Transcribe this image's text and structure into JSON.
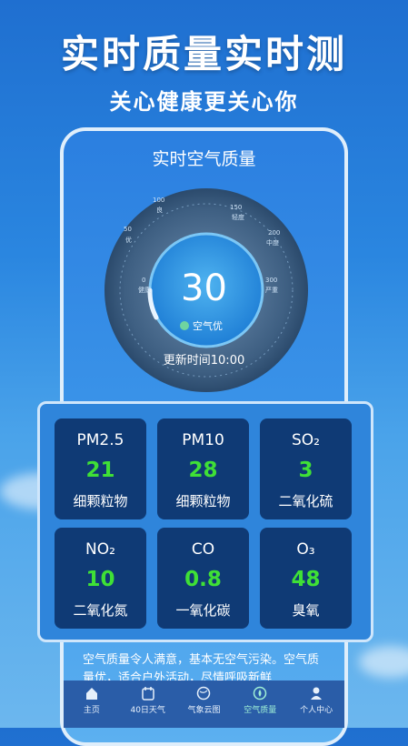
{
  "headline": "实时质量实时测",
  "subline": "关心健康更关心你",
  "screen": {
    "title": "实时空气质量",
    "aqi_value": "30",
    "aqi_level": "空气优",
    "update_time": "更新时间10:00",
    "gauge_ticks": [
      "0",
      "健康",
      "50",
      "优",
      "100",
      "良",
      "150",
      "轻度",
      "200",
      "中度",
      "300",
      "严重"
    ]
  },
  "pollutants": [
    {
      "name": "PM2.5",
      "value": "21",
      "desc": "细颗粒物"
    },
    {
      "name": "PM10",
      "value": "28",
      "desc": "细颗粒物"
    },
    {
      "name": "SO₂",
      "value": "3",
      "desc": "二氧化硫"
    },
    {
      "name": "NO₂",
      "value": "10",
      "desc": "二氧化氮"
    },
    {
      "name": "CO",
      "value": "0.8",
      "desc": "一氧化碳"
    },
    {
      "name": "O₃",
      "value": "48",
      "desc": "臭氧"
    }
  ],
  "description": "空气质量令人满意，基本无空气污染。空气质量优，适合户外活动，尽情呼吸新鲜",
  "tabs": [
    {
      "label": "主页",
      "icon": "home-icon"
    },
    {
      "label": "40日天气",
      "icon": "calendar-icon"
    },
    {
      "label": "气象云图",
      "icon": "globe-icon"
    },
    {
      "label": "空气质量",
      "icon": "leaf-icon",
      "active": true
    },
    {
      "label": "个人中心",
      "icon": "user-icon"
    }
  ],
  "colors": {
    "value_green": "#3fe036",
    "card_bg": "#0f3a75",
    "active_tab": "#9ff0d6"
  }
}
